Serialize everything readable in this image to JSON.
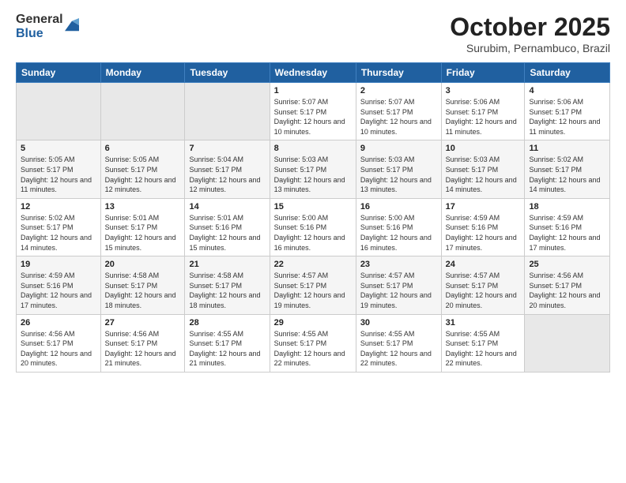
{
  "logo": {
    "general": "General",
    "blue": "Blue"
  },
  "header": {
    "month": "October 2025",
    "location": "Surubim, Pernambuco, Brazil"
  },
  "weekdays": [
    "Sunday",
    "Monday",
    "Tuesday",
    "Wednesday",
    "Thursday",
    "Friday",
    "Saturday"
  ],
  "weeks": [
    [
      {
        "day": "",
        "sunrise": "",
        "sunset": "",
        "daylight": ""
      },
      {
        "day": "",
        "sunrise": "",
        "sunset": "",
        "daylight": ""
      },
      {
        "day": "",
        "sunrise": "",
        "sunset": "",
        "daylight": ""
      },
      {
        "day": "1",
        "sunrise": "Sunrise: 5:07 AM",
        "sunset": "Sunset: 5:17 PM",
        "daylight": "Daylight: 12 hours and 10 minutes."
      },
      {
        "day": "2",
        "sunrise": "Sunrise: 5:07 AM",
        "sunset": "Sunset: 5:17 PM",
        "daylight": "Daylight: 12 hours and 10 minutes."
      },
      {
        "day": "3",
        "sunrise": "Sunrise: 5:06 AM",
        "sunset": "Sunset: 5:17 PM",
        "daylight": "Daylight: 12 hours and 11 minutes."
      },
      {
        "day": "4",
        "sunrise": "Sunrise: 5:06 AM",
        "sunset": "Sunset: 5:17 PM",
        "daylight": "Daylight: 12 hours and 11 minutes."
      }
    ],
    [
      {
        "day": "5",
        "sunrise": "Sunrise: 5:05 AM",
        "sunset": "Sunset: 5:17 PM",
        "daylight": "Daylight: 12 hours and 11 minutes."
      },
      {
        "day": "6",
        "sunrise": "Sunrise: 5:05 AM",
        "sunset": "Sunset: 5:17 PM",
        "daylight": "Daylight: 12 hours and 12 minutes."
      },
      {
        "day": "7",
        "sunrise": "Sunrise: 5:04 AM",
        "sunset": "Sunset: 5:17 PM",
        "daylight": "Daylight: 12 hours and 12 minutes."
      },
      {
        "day": "8",
        "sunrise": "Sunrise: 5:03 AM",
        "sunset": "Sunset: 5:17 PM",
        "daylight": "Daylight: 12 hours and 13 minutes."
      },
      {
        "day": "9",
        "sunrise": "Sunrise: 5:03 AM",
        "sunset": "Sunset: 5:17 PM",
        "daylight": "Daylight: 12 hours and 13 minutes."
      },
      {
        "day": "10",
        "sunrise": "Sunrise: 5:03 AM",
        "sunset": "Sunset: 5:17 PM",
        "daylight": "Daylight: 12 hours and 14 minutes."
      },
      {
        "day": "11",
        "sunrise": "Sunrise: 5:02 AM",
        "sunset": "Sunset: 5:17 PM",
        "daylight": "Daylight: 12 hours and 14 minutes."
      }
    ],
    [
      {
        "day": "12",
        "sunrise": "Sunrise: 5:02 AM",
        "sunset": "Sunset: 5:17 PM",
        "daylight": "Daylight: 12 hours and 14 minutes."
      },
      {
        "day": "13",
        "sunrise": "Sunrise: 5:01 AM",
        "sunset": "Sunset: 5:17 PM",
        "daylight": "Daylight: 12 hours and 15 minutes."
      },
      {
        "day": "14",
        "sunrise": "Sunrise: 5:01 AM",
        "sunset": "Sunset: 5:16 PM",
        "daylight": "Daylight: 12 hours and 15 minutes."
      },
      {
        "day": "15",
        "sunrise": "Sunrise: 5:00 AM",
        "sunset": "Sunset: 5:16 PM",
        "daylight": "Daylight: 12 hours and 16 minutes."
      },
      {
        "day": "16",
        "sunrise": "Sunrise: 5:00 AM",
        "sunset": "Sunset: 5:16 PM",
        "daylight": "Daylight: 12 hours and 16 minutes."
      },
      {
        "day": "17",
        "sunrise": "Sunrise: 4:59 AM",
        "sunset": "Sunset: 5:16 PM",
        "daylight": "Daylight: 12 hours and 17 minutes."
      },
      {
        "day": "18",
        "sunrise": "Sunrise: 4:59 AM",
        "sunset": "Sunset: 5:16 PM",
        "daylight": "Daylight: 12 hours and 17 minutes."
      }
    ],
    [
      {
        "day": "19",
        "sunrise": "Sunrise: 4:59 AM",
        "sunset": "Sunset: 5:16 PM",
        "daylight": "Daylight: 12 hours and 17 minutes."
      },
      {
        "day": "20",
        "sunrise": "Sunrise: 4:58 AM",
        "sunset": "Sunset: 5:17 PM",
        "daylight": "Daylight: 12 hours and 18 minutes."
      },
      {
        "day": "21",
        "sunrise": "Sunrise: 4:58 AM",
        "sunset": "Sunset: 5:17 PM",
        "daylight": "Daylight: 12 hours and 18 minutes."
      },
      {
        "day": "22",
        "sunrise": "Sunrise: 4:57 AM",
        "sunset": "Sunset: 5:17 PM",
        "daylight": "Daylight: 12 hours and 19 minutes."
      },
      {
        "day": "23",
        "sunrise": "Sunrise: 4:57 AM",
        "sunset": "Sunset: 5:17 PM",
        "daylight": "Daylight: 12 hours and 19 minutes."
      },
      {
        "day": "24",
        "sunrise": "Sunrise: 4:57 AM",
        "sunset": "Sunset: 5:17 PM",
        "daylight": "Daylight: 12 hours and 20 minutes."
      },
      {
        "day": "25",
        "sunrise": "Sunrise: 4:56 AM",
        "sunset": "Sunset: 5:17 PM",
        "daylight": "Daylight: 12 hours and 20 minutes."
      }
    ],
    [
      {
        "day": "26",
        "sunrise": "Sunrise: 4:56 AM",
        "sunset": "Sunset: 5:17 PM",
        "daylight": "Daylight: 12 hours and 20 minutes."
      },
      {
        "day": "27",
        "sunrise": "Sunrise: 4:56 AM",
        "sunset": "Sunset: 5:17 PM",
        "daylight": "Daylight: 12 hours and 21 minutes."
      },
      {
        "day": "28",
        "sunrise": "Sunrise: 4:55 AM",
        "sunset": "Sunset: 5:17 PM",
        "daylight": "Daylight: 12 hours and 21 minutes."
      },
      {
        "day": "29",
        "sunrise": "Sunrise: 4:55 AM",
        "sunset": "Sunset: 5:17 PM",
        "daylight": "Daylight: 12 hours and 22 minutes."
      },
      {
        "day": "30",
        "sunrise": "Sunrise: 4:55 AM",
        "sunset": "Sunset: 5:17 PM",
        "daylight": "Daylight: 12 hours and 22 minutes."
      },
      {
        "day": "31",
        "sunrise": "Sunrise: 4:55 AM",
        "sunset": "Sunset: 5:17 PM",
        "daylight": "Daylight: 12 hours and 22 minutes."
      },
      {
        "day": "",
        "sunrise": "",
        "sunset": "",
        "daylight": ""
      }
    ]
  ]
}
